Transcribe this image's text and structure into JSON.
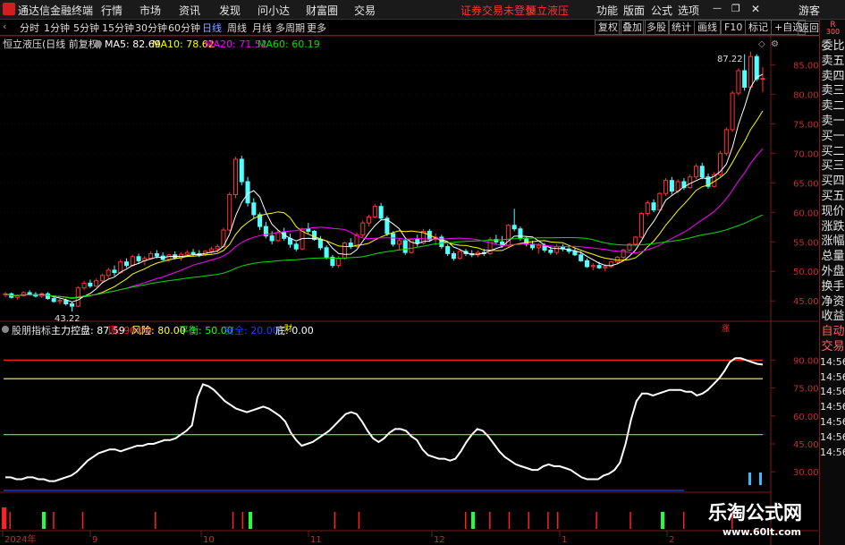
{
  "menubar": {
    "app_title": "通达信金融终端",
    "items": [
      "行情",
      "市场",
      "资讯",
      "发现",
      "问小达",
      "财富圈",
      "交易"
    ],
    "status_left": "证券交易未登录",
    "status_right": "恒立液压",
    "right_items": [
      "功能",
      "版面",
      "公式",
      "选项"
    ],
    "guest": "游客",
    "colors": {
      "status": "#ff3030",
      "bar": "#1a1a1a"
    }
  },
  "toolbar": {
    "periods": [
      "分时",
      "1分钟",
      "5分钟",
      "15分钟",
      "30分钟",
      "60分钟",
      "日线",
      "周线",
      "月线",
      "多周期",
      "更多"
    ],
    "selected": "日线",
    "right_buttons": [
      "复权",
      "叠加",
      "多股",
      "统计",
      "画线",
      "F10",
      "标记",
      "+自选",
      "返回"
    ]
  },
  "main_chart": {
    "title": "恒立液压(日线 前复权)",
    "ma": [
      {
        "label": "MA5: 82.69",
        "color": "#ffffff"
      },
      {
        "label": "MA10: 78.62",
        "color": "#ffff00"
      },
      {
        "label": "MA20: 71.52",
        "color": "#ff00ff"
      },
      {
        "label": "MA60: 60.19",
        "color": "#00e000"
      }
    ],
    "high_label": "87.22",
    "low_label": "43.22",
    "markers": {
      "cai": "财",
      "zhang": "涨"
    },
    "ylim": [
      42,
      89
    ],
    "ticks": [
      "85.00",
      "80.00",
      "75.00",
      "70.00",
      "65.00",
      "60.00",
      "55.00",
      "50.00",
      "45.00"
    ]
  },
  "indicator": {
    "name": "股朋指标",
    "values": [
      {
        "label": "主力控盘: 87.59",
        "color": "#ffffff"
      },
      {
        "label": "顶: 90.00",
        "color": "#ff2020"
      },
      {
        "label": "风险: 80.00",
        "color": "#ffff60"
      },
      {
        "label": "平衡: 50.00",
        "color": "#20ff20"
      },
      {
        "label": "安全: 20.00",
        "color": "#2040ff"
      },
      {
        "label": "底: 0.00",
        "color": "#ffffff"
      }
    ],
    "ticks": [
      "90.00",
      "75.00",
      "60.00",
      "45.00",
      "30.00"
    ],
    "ylim": [
      20,
      95
    ]
  },
  "time_axis": [
    "2024年",
    "9",
    "10",
    "11",
    "12",
    "1",
    "2"
  ],
  "sidebar": {
    "top_label": "R",
    "top_sub": "300",
    "tabs": [
      "委比",
      "卖五",
      "卖四",
      "卖三",
      "卖二",
      "卖一",
      "买一",
      "买二",
      "买三",
      "买四",
      "买五",
      "现价",
      "涨跌",
      "涨幅",
      "总量",
      "外盘",
      "换手",
      "净资",
      "收益",
      "自动",
      "交易",
      "14:56",
      "14:56",
      "14:56",
      "14:56",
      "14:56",
      "14:56",
      "14:56"
    ]
  },
  "watermark": {
    "title": "乐淘公式网",
    "url": "www.60lt.com"
  },
  "chart_data": {
    "type": "candlestick",
    "ohlc": [
      [
        46.0,
        46.5,
        45.6,
        46.2
      ],
      [
        46.2,
        46.4,
        45.4,
        45.6
      ],
      [
        45.6,
        46.1,
        45.2,
        45.9
      ],
      [
        45.9,
        46.6,
        45.7,
        46.4
      ],
      [
        46.4,
        46.8,
        45.9,
        46.1
      ],
      [
        46.1,
        46.5,
        45.6,
        45.8
      ],
      [
        45.8,
        46.4,
        45.5,
        46.2
      ],
      [
        46.2,
        46.5,
        45.2,
        45.4
      ],
      [
        45.4,
        45.7,
        44.7,
        44.9
      ],
      [
        44.9,
        45.4,
        44.4,
        45.1
      ],
      [
        45.1,
        45.4,
        44.2,
        44.5
      ],
      [
        44.5,
        44.8,
        43.2,
        44.1
      ],
      [
        44.1,
        47.5,
        44.0,
        47.2
      ],
      [
        47.2,
        48.4,
        46.8,
        48.0
      ],
      [
        48.0,
        48.6,
        47.2,
        47.5
      ],
      [
        47.5,
        48.8,
        47.3,
        48.4
      ],
      [
        48.4,
        49.6,
        48.0,
        49.3
      ],
      [
        49.3,
        50.6,
        48.8,
        50.2
      ],
      [
        50.2,
        51.0,
        49.2,
        49.8
      ],
      [
        49.8,
        52.0,
        49.6,
        51.6
      ],
      [
        51.6,
        52.2,
        50.6,
        51.0
      ],
      [
        51.0,
        52.8,
        50.8,
        52.5
      ],
      [
        52.5,
        53.0,
        51.4,
        51.8
      ],
      [
        51.8,
        52.6,
        51.0,
        52.2
      ],
      [
        52.2,
        53.4,
        52.0,
        53.0
      ],
      [
        53.0,
        53.6,
        52.2,
        52.6
      ],
      [
        52.6,
        53.2,
        51.8,
        52.0
      ],
      [
        52.0,
        53.0,
        51.6,
        52.8
      ],
      [
        52.8,
        53.4,
        52.0,
        52.3
      ],
      [
        52.3,
        53.2,
        51.8,
        52.9
      ],
      [
        52.9,
        53.6,
        52.4,
        53.2
      ],
      [
        53.2,
        53.8,
        52.6,
        53.0
      ],
      [
        53.0,
        53.6,
        52.4,
        52.8
      ],
      [
        52.8,
        53.6,
        52.6,
        53.4
      ],
      [
        53.4,
        54.2,
        53.0,
        53.8
      ],
      [
        53.8,
        54.6,
        53.2,
        54.2
      ],
      [
        54.2,
        57.4,
        54.0,
        57.0
      ],
      [
        57.0,
        63.4,
        56.8,
        63.0
      ],
      [
        63.0,
        69.4,
        62.4,
        69.0
      ],
      [
        69.0,
        69.6,
        64.6,
        65.2
      ],
      [
        65.2,
        66.0,
        61.0,
        61.6
      ],
      [
        61.6,
        62.4,
        59.0,
        59.6
      ],
      [
        59.6,
        60.0,
        57.0,
        57.6
      ],
      [
        57.6,
        58.4,
        55.6,
        56.0
      ],
      [
        56.0,
        56.8,
        54.6,
        55.2
      ],
      [
        55.2,
        57.0,
        55.0,
        56.6
      ],
      [
        56.6,
        57.4,
        55.2,
        55.6
      ],
      [
        55.6,
        56.4,
        54.0,
        54.6
      ],
      [
        54.6,
        55.0,
        53.4,
        53.8
      ],
      [
        53.8,
        57.4,
        53.6,
        57.2
      ],
      [
        57.2,
        58.2,
        56.4,
        56.8
      ],
      [
        56.8,
        57.0,
        55.2,
        55.4
      ],
      [
        55.4,
        56.0,
        53.6,
        54.0
      ],
      [
        54.0,
        54.4,
        52.0,
        52.4
      ],
      [
        52.4,
        52.8,
        50.6,
        51.0
      ],
      [
        51.0,
        52.6,
        50.6,
        52.2
      ],
      [
        52.2,
        55.0,
        52.0,
        54.8
      ],
      [
        54.8,
        55.6,
        53.8,
        54.2
      ],
      [
        54.2,
        56.6,
        54.0,
        56.2
      ],
      [
        56.2,
        58.6,
        55.8,
        58.2
      ],
      [
        58.2,
        59.6,
        57.6,
        59.2
      ],
      [
        59.2,
        61.4,
        59.0,
        61.0
      ],
      [
        61.0,
        61.6,
        58.6,
        59.0
      ],
      [
        59.0,
        59.4,
        56.0,
        56.4
      ],
      [
        56.4,
        56.8,
        54.2,
        54.6
      ],
      [
        54.6,
        55.6,
        53.6,
        55.2
      ],
      [
        55.2,
        55.6,
        52.8,
        53.2
      ],
      [
        53.2,
        55.6,
        53.0,
        55.4
      ],
      [
        55.4,
        56.2,
        54.2,
        54.8
      ],
      [
        54.8,
        57.2,
        54.6,
        56.8
      ],
      [
        56.8,
        57.2,
        55.0,
        55.4
      ],
      [
        55.4,
        56.4,
        54.4,
        55.8
      ],
      [
        55.8,
        56.2,
        53.8,
        54.2
      ],
      [
        54.2,
        54.6,
        52.6,
        53.0
      ],
      [
        53.0,
        53.4,
        51.8,
        52.2
      ],
      [
        52.2,
        53.6,
        52.0,
        53.4
      ],
      [
        53.4,
        53.8,
        52.6,
        53.0
      ],
      [
        53.0,
        53.6,
        52.4,
        52.8
      ],
      [
        52.8,
        53.6,
        52.4,
        53.2
      ],
      [
        53.2,
        53.8,
        52.6,
        53.0
      ],
      [
        53.0,
        55.8,
        52.8,
        55.4
      ],
      [
        55.4,
        56.2,
        54.6,
        55.0
      ],
      [
        55.0,
        56.0,
        54.0,
        54.4
      ],
      [
        54.4,
        58.0,
        54.2,
        57.8
      ],
      [
        57.8,
        60.6,
        56.8,
        57.2
      ],
      [
        57.2,
        57.6,
        55.2,
        55.6
      ],
      [
        55.6,
        56.0,
        54.2,
        54.6
      ],
      [
        54.6,
        55.2,
        53.6,
        54.0
      ],
      [
        54.0,
        54.8,
        53.0,
        54.4
      ],
      [
        54.4,
        54.8,
        53.2,
        53.6
      ],
      [
        53.6,
        54.2,
        52.8,
        53.2
      ],
      [
        53.2,
        54.6,
        52.8,
        54.2
      ],
      [
        54.2,
        54.6,
        53.4,
        53.8
      ],
      [
        53.8,
        54.4,
        53.0,
        53.4
      ],
      [
        53.4,
        54.0,
        52.6,
        52.8
      ],
      [
        52.8,
        53.4,
        51.6,
        51.8
      ],
      [
        51.8,
        52.2,
        50.6,
        50.8
      ],
      [
        50.8,
        51.4,
        50.2,
        51.0
      ],
      [
        51.0,
        51.6,
        50.4,
        50.6
      ],
      [
        50.6,
        51.2,
        50.0,
        50.8
      ],
      [
        50.8,
        51.8,
        50.6,
        51.6
      ],
      [
        51.6,
        52.6,
        51.2,
        52.4
      ],
      [
        52.4,
        53.8,
        52.0,
        53.6
      ],
      [
        53.6,
        54.8,
        53.4,
        54.6
      ],
      [
        54.6,
        56.0,
        54.2,
        55.8
      ],
      [
        55.8,
        60.0,
        55.6,
        59.8
      ],
      [
        59.8,
        62.0,
        59.4,
        61.6
      ],
      [
        61.6,
        62.2,
        60.0,
        60.4
      ],
      [
        60.4,
        63.4,
        60.2,
        63.2
      ],
      [
        63.2,
        65.8,
        62.8,
        65.4
      ],
      [
        65.4,
        66.0,
        63.0,
        63.6
      ],
      [
        63.6,
        65.6,
        63.2,
        65.2
      ],
      [
        65.2,
        65.8,
        63.8,
        64.2
      ],
      [
        64.2,
        66.4,
        64.0,
        66.0
      ],
      [
        66.0,
        68.2,
        65.6,
        67.8
      ],
      [
        67.8,
        68.4,
        65.6,
        66.0
      ],
      [
        66.0,
        66.6,
        64.0,
        64.4
      ],
      [
        64.4,
        66.8,
        64.2,
        66.4
      ],
      [
        66.4,
        70.4,
        66.0,
        70.0
      ],
      [
        70.0,
        74.4,
        69.6,
        74.0
      ],
      [
        74.0,
        80.6,
        73.6,
        80.2
      ],
      [
        80.2,
        84.4,
        79.8,
        84.0
      ],
      [
        84.0,
        86.8,
        80.6,
        81.2
      ],
      [
        81.2,
        87.22,
        80.8,
        86.4
      ],
      [
        86.4,
        86.8,
        82.2,
        82.6
      ],
      [
        82.6,
        84.6,
        80.4,
        82.69
      ]
    ],
    "ma5_last": 82.69,
    "ma10_last": 78.62,
    "ma20_last": 71.52,
    "ma60_last": 60.19,
    "indicator_main": [
      27,
      27,
      26,
      26,
      27,
      27,
      26,
      26,
      25,
      25,
      26,
      27,
      28,
      30,
      33,
      36,
      38,
      40,
      41,
      42,
      42,
      41,
      42,
      43,
      44,
      44,
      45,
      45,
      46,
      47,
      47,
      48,
      50,
      52,
      55,
      70,
      77,
      76,
      74,
      71,
      68,
      66,
      64,
      63,
      62,
      63,
      64,
      65,
      64,
      62,
      60,
      57,
      51,
      47,
      44,
      45,
      46,
      48,
      50,
      52,
      55,
      58,
      61,
      62,
      61,
      57,
      52,
      48,
      46,
      48,
      51,
      53,
      53,
      52,
      49,
      47,
      42,
      39,
      38,
      37,
      37,
      36,
      37,
      41,
      46,
      50,
      53,
      52,
      49,
      45,
      41,
      38,
      36,
      34,
      33,
      32,
      31,
      31,
      33,
      34,
      33,
      33,
      32,
      31,
      29,
      27,
      26,
      26,
      26,
      28,
      29,
      31,
      35,
      45,
      58,
      68,
      72,
      72,
      71,
      72,
      73,
      74,
      74,
      74,
      73,
      73,
      71,
      72,
      74,
      77,
      80,
      84,
      89,
      91,
      91,
      90,
      89,
      88,
      87.59
    ],
    "indicator_lines": {
      "top": 90,
      "risk": 80,
      "balance": 50,
      "safe": 20,
      "bottom": 0
    }
  }
}
